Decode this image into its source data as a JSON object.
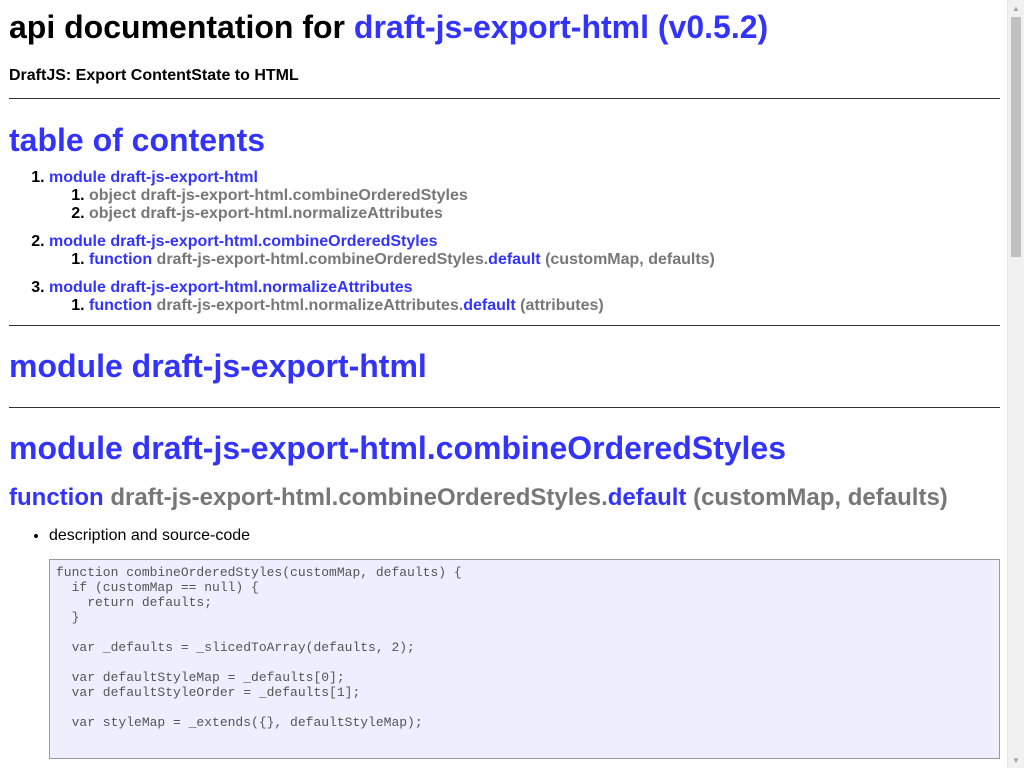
{
  "header": {
    "title_prefix": "api documentation for ",
    "title_link": "draft-js-export-html (v0.5.2)",
    "subtitle": "DraftJS: Export ContentState to HTML"
  },
  "toc": {
    "heading": "table of contents",
    "items": [
      {
        "number": "1.",
        "label": "module draft-js-export-html",
        "children": [
          {
            "kind": "object",
            "name": "draft-js-export-html.combineOrderedStyles"
          },
          {
            "kind": "object",
            "name": "draft-js-export-html.normalizeAttributes"
          }
        ]
      },
      {
        "number": "2.",
        "label": "module draft-js-export-html.combineOrderedStyles",
        "children": [
          {
            "kind": "function",
            "name": "draft-js-export-html.combineOrderedStyles.",
            "member": "default",
            "args": "(customMap, defaults)"
          }
        ]
      },
      {
        "number": "3.",
        "label": "module draft-js-export-html.normalizeAttributes",
        "children": [
          {
            "kind": "function",
            "name": "draft-js-export-html.normalizeAttributes.",
            "member": "default",
            "args": "(attributes)"
          }
        ]
      }
    ]
  },
  "sections": {
    "module1_heading": "module draft-js-export-html",
    "module2_heading": "module draft-js-export-html.combineOrderedStyles",
    "function_heading": {
      "kind": "function",
      "name": "draft-js-export-html.combineOrderedStyles.",
      "member": "default",
      "args": "(customMap, defaults)"
    },
    "desc_label": "description and source-code",
    "source_code": "function combineOrderedStyles(customMap, defaults) {\n  if (customMap == null) {\n    return defaults;\n  }\n\n  var _defaults = _slicedToArray(defaults, 2);\n\n  var defaultStyleMap = _defaults[0];\n  var defaultStyleOrder = _defaults[1];\n\n  var styleMap = _extends({}, defaultStyleMap);"
  },
  "colors": {
    "link": "#3333ff",
    "muted": "#777777",
    "code_bg": "#eeeeff"
  }
}
